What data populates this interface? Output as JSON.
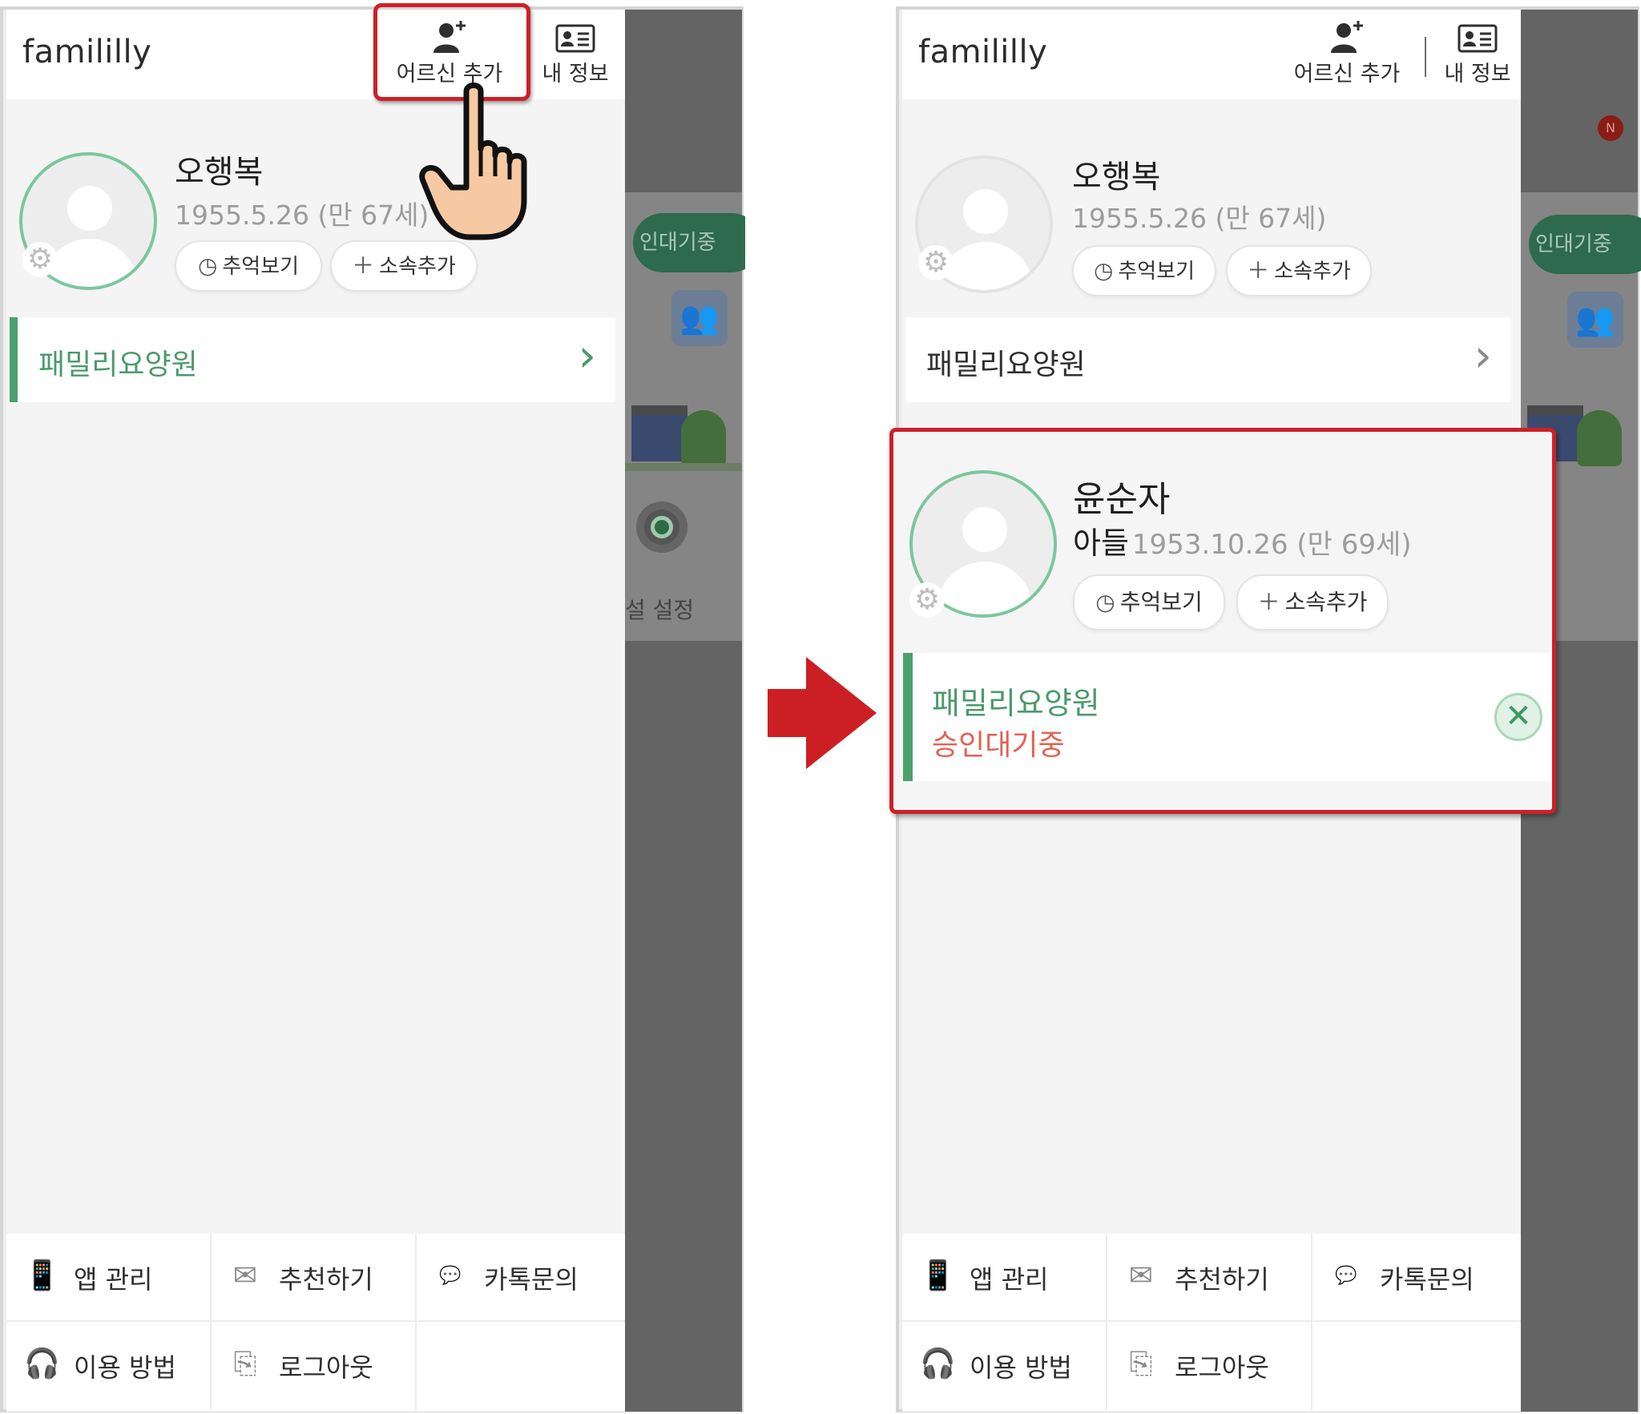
{
  "left": {
    "app_title": "famililly",
    "top_actions": {
      "add_elder": "어르신 추가",
      "my_info": "내 정보"
    },
    "profile": {
      "name": "오행복",
      "birth": "1955.5.26 (만 67세)",
      "memories_btn": "추억보기",
      "add_affil_btn": "소속추가"
    },
    "facility": "패밀리요양원",
    "backdrop": {
      "pending_chip": "인대기중",
      "setting_label": "설 설정"
    }
  },
  "right": {
    "app_title": "famililly",
    "top_actions": {
      "add_elder": "어르신 추가",
      "my_info": "내 정보"
    },
    "profile": {
      "name": "오행복",
      "birth": "1955.5.26 (만 67세)",
      "memories_btn": "추억보기",
      "add_affil_btn": "소속추가"
    },
    "facility": "패밀리요양원",
    "new_elder": {
      "name": "윤순자",
      "relation": "아들",
      "birth": "1953.10.26 (만 69세)",
      "memories_btn": "추억보기",
      "add_affil_btn": "소속추가",
      "facility": "패밀리요양원",
      "status": "승인대기중"
    },
    "backdrop": {
      "pending_chip": "인대기중",
      "notification_badge": "N"
    }
  },
  "bottom_menu": [
    {
      "label": "앱 관리",
      "icon": "phone-icon"
    },
    {
      "label": "추천하기",
      "icon": "mail-heart-icon"
    },
    {
      "label": "카톡문의",
      "icon": "talk-icon"
    },
    {
      "label": "이용 방법",
      "icon": "headset-icon"
    },
    {
      "label": "로그아웃",
      "icon": "logout-icon"
    }
  ],
  "colors": {
    "accent_green": "#4ca06d",
    "highlight_red": "#cc2127",
    "pending_red": "#e26153"
  }
}
